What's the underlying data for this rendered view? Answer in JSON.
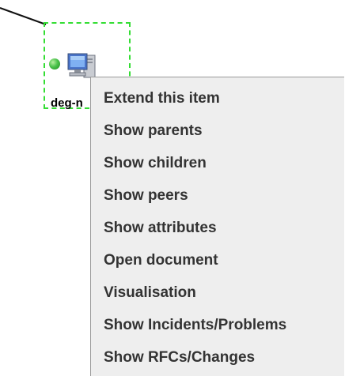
{
  "node": {
    "label": "deg-n",
    "status": "online",
    "status_color": "#4cc24c",
    "selection_border_color": "#33dd33",
    "icon": "computer-icon"
  },
  "context_menu": {
    "background_color": "#eeeeee",
    "items": [
      {
        "label": "Extend this item"
      },
      {
        "label": "Show parents"
      },
      {
        "label": "Show children"
      },
      {
        "label": "Show peers"
      },
      {
        "label": "Show attributes"
      },
      {
        "label": "Open document"
      },
      {
        "label": "Visualisation"
      },
      {
        "label": "Show Incidents/Problems"
      },
      {
        "label": "Show RFCs/Changes"
      }
    ]
  }
}
